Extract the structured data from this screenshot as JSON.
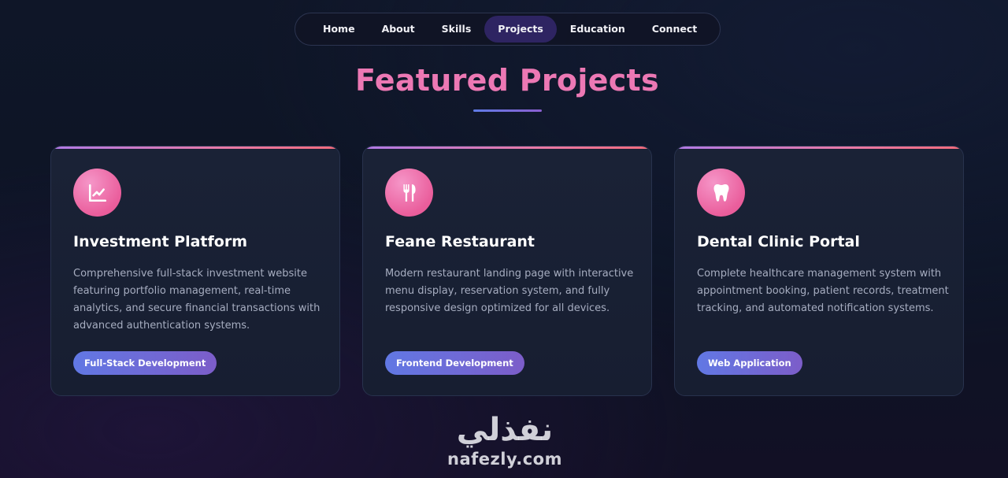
{
  "nav": {
    "items": [
      {
        "label": "Home",
        "active": false
      },
      {
        "label": "About",
        "active": false
      },
      {
        "label": "Skills",
        "active": false
      },
      {
        "label": "Projects",
        "active": true
      },
      {
        "label": "Education",
        "active": false
      },
      {
        "label": "Connect",
        "active": false
      }
    ]
  },
  "section": {
    "title": "Featured Projects"
  },
  "projects": [
    {
      "icon": "chart-line-icon",
      "title": "Investment Platform",
      "description": "Comprehensive full-stack investment website featuring portfolio management, real-time analytics, and secure financial transactions with advanced authentication systems.",
      "tag": "Full-Stack Development"
    },
    {
      "icon": "utensils-icon",
      "title": "Feane Restaurant",
      "description": "Modern restaurant landing page with interactive menu display, reservation system, and fully responsive design optimized for all devices.",
      "tag": "Frontend Development"
    },
    {
      "icon": "tooth-icon",
      "title": "Dental Clinic Portal",
      "description": "Complete healthcare management system with appointment booking, patient records, treatment tracking, and automated notification systems.",
      "tag": "Web Application"
    }
  ],
  "watermark": {
    "arabic": "نفذلي",
    "latin": "nafezly.com"
  },
  "colors": {
    "title_pink": "#ec78b4",
    "active_nav_bg": "#2e2462",
    "icon_pink": "#ea5e9c",
    "tag_gradient_start": "#6178e4",
    "tag_gradient_end": "#7c5dc9"
  }
}
